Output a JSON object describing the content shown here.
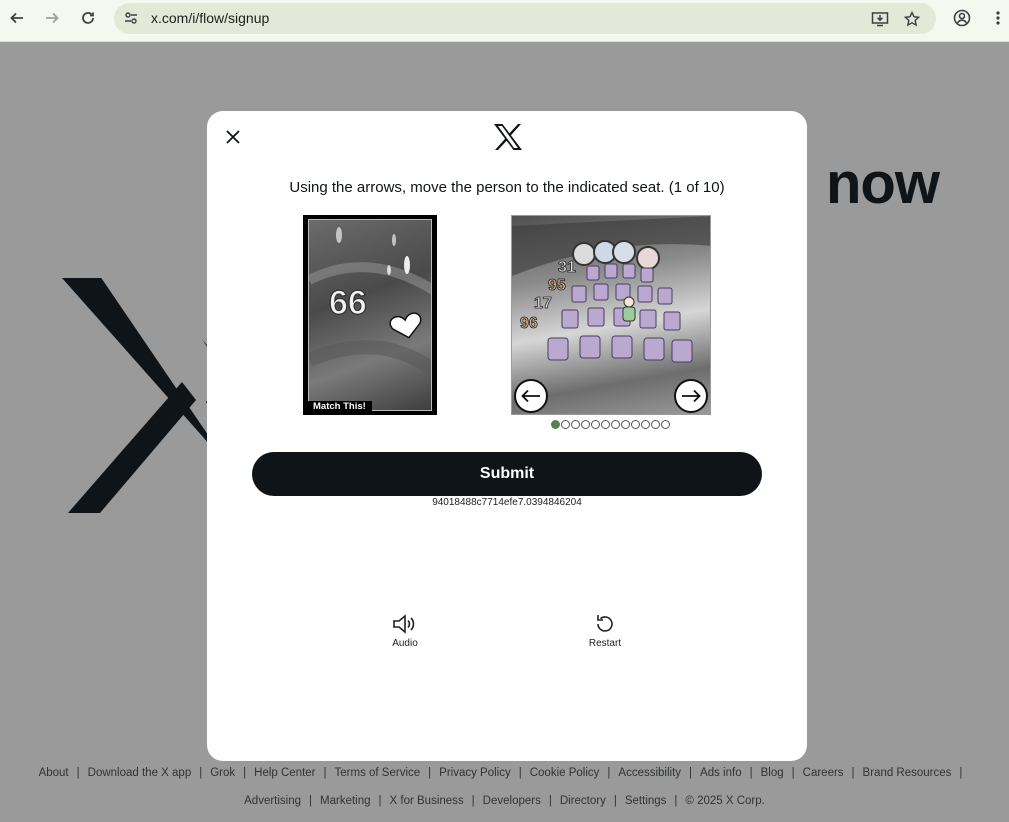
{
  "browser": {
    "url": "x.com/i/flow/signup"
  },
  "background": {
    "headline_fragment": "now"
  },
  "modal": {
    "instruction": "Using the arrows, move the person to the indicated seat. (1 of 10)",
    "target_label": "Match This!",
    "target_numbers": [
      "66"
    ],
    "puzzle_numbers": [
      "31",
      "95",
      "17",
      "96"
    ],
    "progress": {
      "current": 1,
      "total": 12
    },
    "submit_label": "Submit",
    "session_id": "94018488c7714efe7.0394846204",
    "audio_label": "Audio",
    "restart_label": "Restart"
  },
  "footer": {
    "row1": [
      "About",
      "Download the X app",
      "Grok",
      "Help Center",
      "Terms of Service",
      "Privacy Policy",
      "Cookie Policy",
      "Accessibility",
      "Ads info",
      "Blog",
      "Careers",
      "Brand Resources"
    ],
    "row2": [
      "Advertising",
      "Marketing",
      "X for Business",
      "Developers",
      "Directory",
      "Settings",
      "© 2025 X Corp."
    ]
  },
  "colors": {
    "accent": "#0f1419",
    "progress_active": "#5b7d58",
    "overlay": "#9a9a9a"
  }
}
